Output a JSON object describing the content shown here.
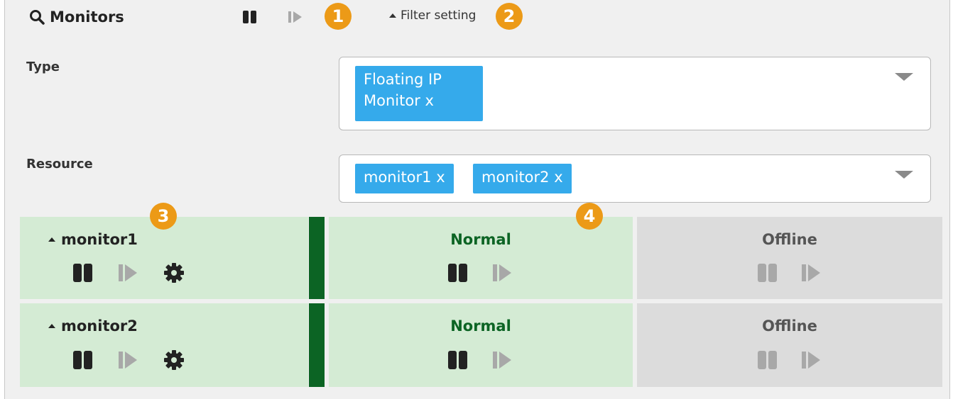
{
  "header": {
    "title": "Monitors",
    "title_icon": "search-icon",
    "pause_icon": "pause-icon",
    "resume_icon": "resume-icon",
    "filter_label": "Filter setting",
    "filter_icon": "triangle-up-icon"
  },
  "callouts": [
    "1",
    "2",
    "3",
    "4"
  ],
  "filters": {
    "type": {
      "label": "Type",
      "tags": [
        {
          "line1": "Floating IP",
          "line2": "Monitor x"
        }
      ]
    },
    "resource": {
      "label": "Resource",
      "tags": [
        "monitor1 x",
        "monitor2 x"
      ]
    }
  },
  "monitors": [
    {
      "name": "monitor1",
      "status": "Normal",
      "server_status": "Offline"
    },
    {
      "name": "monitor2",
      "status": "Normal",
      "server_status": "Offline"
    }
  ],
  "colors": {
    "normal_bg": "#d4ebd4",
    "normal_bar": "#0c6424",
    "normal_text": "#0c6424",
    "offline_bg": "#dcdcdc",
    "offline_text": "#555555",
    "tag_bg": "#35aaeb",
    "callout_bg": "#ec9a17"
  }
}
